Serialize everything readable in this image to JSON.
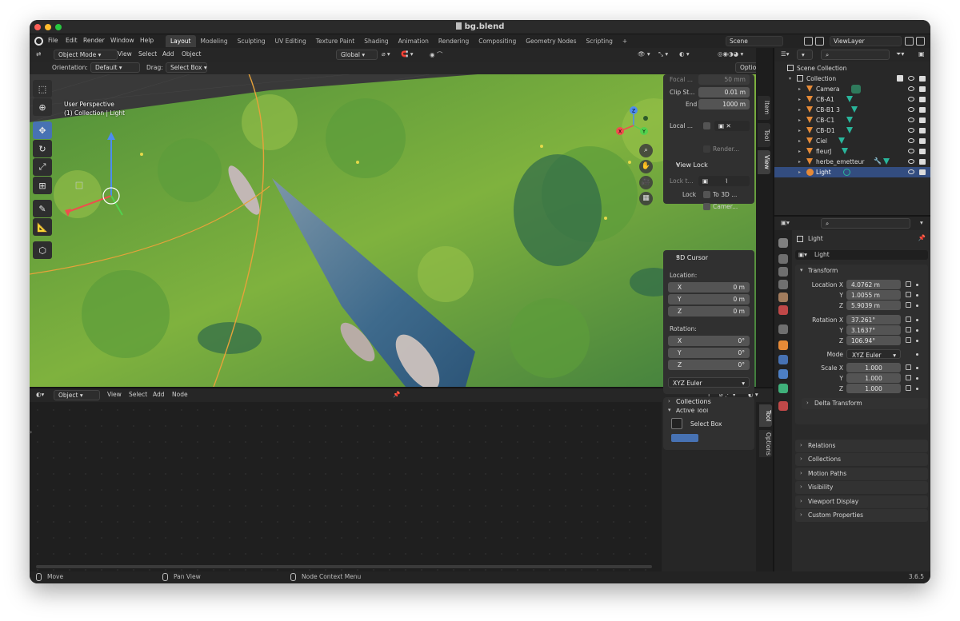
{
  "window": {
    "title": "bg.blend"
  },
  "menu": [
    "File",
    "Edit",
    "Render",
    "Window",
    "Help"
  ],
  "workspaces": [
    "Layout",
    "Modeling",
    "Sculpting",
    "UV Editing",
    "Texture Paint",
    "Shading",
    "Animation",
    "Rendering",
    "Compositing",
    "Geometry Nodes",
    "Scripting"
  ],
  "workspace_add": "+",
  "scene": {
    "scene_name": "Scene",
    "view_layer": "ViewLayer"
  },
  "viewport": {
    "mode": "Object Mode",
    "menus": [
      "View",
      "Select",
      "Add",
      "Object"
    ],
    "transform_orientation": "Global",
    "orientation_label": "Orientation:",
    "orientation_value": "Default",
    "drag_label": "Drag:",
    "drag_value": "Select Box",
    "options": "Options",
    "overlay_line1": "User Perspective",
    "overlay_line2": "(1) Collection | Light",
    "gizmo": {
      "x": "X",
      "y": "Y",
      "z": "Z"
    }
  },
  "npanel": {
    "focal_label": "Focal ...",
    "focal_value": "50 mm",
    "clip_start_label": "Clip St...",
    "clip_start_value": "0.01 m",
    "clip_end_label": "End",
    "clip_end_value": "1000 m",
    "local_label": "Local ...",
    "render_label": "Render...",
    "view_lock_title": "View Lock",
    "lock_to_label": "Lock t...",
    "lock_label": "Lock",
    "to_3d_label": "To 3D ...",
    "camera_label": "Camer...",
    "cursor_title": "3D Cursor",
    "location_label": "Location:",
    "loc": [
      {
        "axis": "X",
        "value": "0 m"
      },
      {
        "axis": "Y",
        "value": "0 m"
      },
      {
        "axis": "Z",
        "value": "0 m"
      }
    ],
    "rotation_label": "Rotation:",
    "rot": [
      {
        "axis": "X",
        "value": "0°"
      },
      {
        "axis": "Y",
        "value": "0°"
      },
      {
        "axis": "Z",
        "value": "0°"
      }
    ],
    "rotation_mode": "XYZ Euler",
    "collections_title": "Collections",
    "tabs": [
      "Item",
      "Tool",
      "View"
    ]
  },
  "node_editor": {
    "object_dropdown": "Object",
    "menus": [
      "View",
      "Select",
      "Add",
      "Node"
    ],
    "active_tool_title": "Active Tool",
    "select_box": "Select Box",
    "tabs": [
      "Tool",
      "Options"
    ]
  },
  "outliner": {
    "scene_collection": "Scene Collection",
    "collection": "Collection",
    "items": [
      "Camera",
      "CB-A1",
      "CB-B1 3",
      "CB-C1",
      "CB-D1",
      "Ciel",
      "fleurJ",
      "herbe_emetteur",
      "Light"
    ],
    "selected": "Light"
  },
  "properties": {
    "object_name": "Light",
    "data_name": "Light",
    "transform_title": "Transform",
    "location_label": "Location X",
    "location": [
      "4.0762 m",
      "1.0055 m",
      "5.9039 m"
    ],
    "rotation_label": "Rotation X",
    "rotation": [
      "37.261°",
      "3.1637°",
      "106.94°"
    ],
    "mode_label": "Mode",
    "mode_value": "XYZ Euler",
    "scale_label": "Scale X",
    "scale": [
      "1.000",
      "1.000",
      "1.000"
    ],
    "axis_y": "Y",
    "axis_z": "Z",
    "delta_transform": "Delta Transform",
    "panels": [
      "Relations",
      "Collections",
      "Motion Paths",
      "Visibility",
      "Viewport Display",
      "Custom Properties"
    ]
  },
  "statusbar": {
    "move": "Move",
    "pan": "Pan View",
    "context": "Node Context Menu",
    "version": "3.6.5"
  },
  "colors": {
    "accent": "#4772b3",
    "selected_row": "#334d80",
    "light_orange": "#e68a37",
    "grass": "#6aa23a"
  }
}
